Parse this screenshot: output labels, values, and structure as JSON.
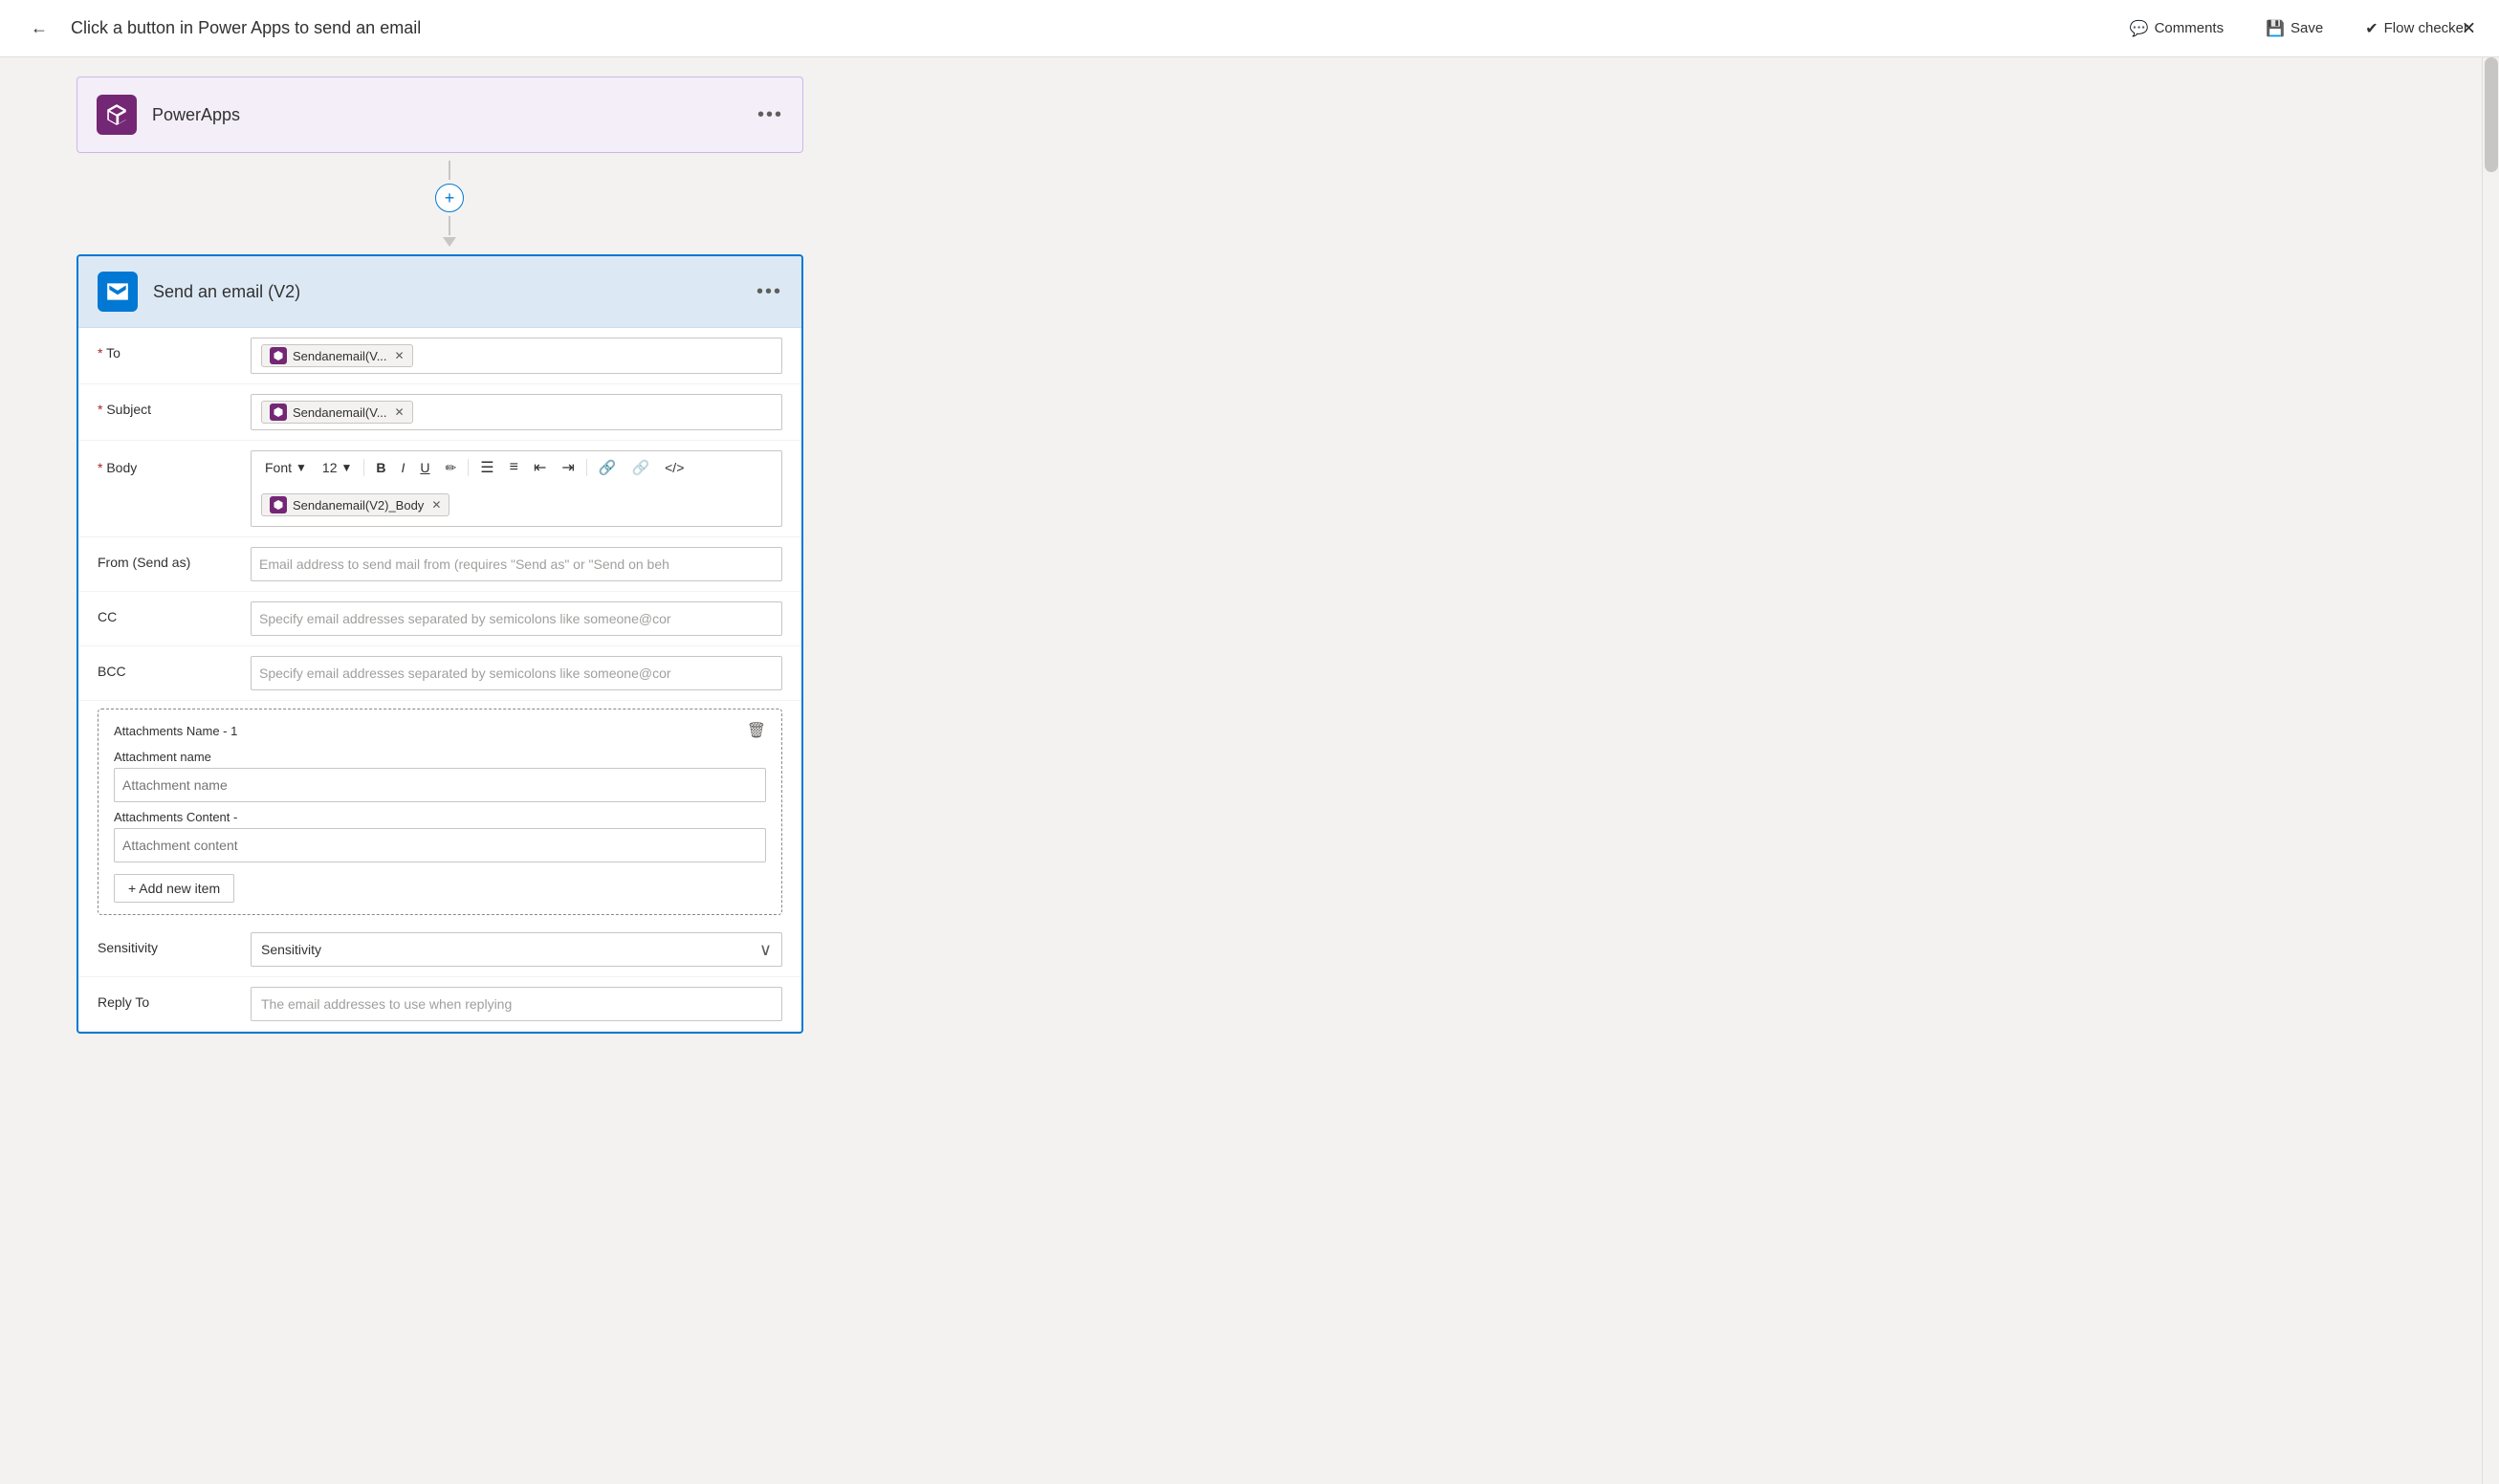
{
  "topbar": {
    "back_label": "←",
    "title": "Click a button in Power Apps to send an email",
    "comments_label": "Comments",
    "save_label": "Save",
    "flow_checker_label": "Flow checker",
    "close_label": "✕"
  },
  "powerapps_card": {
    "title": "PowerApps",
    "menu_label": "•••"
  },
  "connector": {
    "plus_label": "+",
    "plus_aria": "Add step"
  },
  "email_card": {
    "title": "Send an email (V2)",
    "menu_label": "•••"
  },
  "form": {
    "to_label": "To",
    "to_required": true,
    "to_token": "Sendanemail(V...",
    "subject_label": "Subject",
    "subject_required": true,
    "subject_token": "Sendanemail(V...",
    "body_label": "Body",
    "body_required": true,
    "body_font": "Font",
    "body_font_size": "12",
    "body_token": "Sendanemail(V2)_Body",
    "from_label": "From (Send as)",
    "from_placeholder": "Email address to send mail from (requires \"Send as\" or \"Send on beh",
    "cc_label": "CC",
    "cc_placeholder": "Specify email addresses separated by semicolons like someone@cor",
    "bcc_label": "BCC",
    "bcc_placeholder": "Specify email addresses separated by semicolons like someone@cor",
    "attachments_section_title": "Attachments Name - 1",
    "attachment_name_label": "Attachment name",
    "attachment_name_placeholder": "Attachment name",
    "attachment_content_label": "Attachments Content -",
    "attachment_content_placeholder": "Attachment content",
    "add_new_item_label": "+ Add new item",
    "sensitivity_label": "Sensitivity",
    "sensitivity_value": "Sensitivity",
    "reply_to_label": "Reply To",
    "reply_to_placeholder": "The email addresses to use when replying"
  },
  "toolbar": {
    "font_label": "Font",
    "font_size_label": "12",
    "bold_label": "B",
    "italic_label": "I",
    "underline_label": "U",
    "pen_label": "✏",
    "bullet_unordered_label": "≡",
    "bullet_ordered_label": "≡",
    "indent_decrease_label": "⇤",
    "indent_increase_label": "⇥",
    "link_label": "🔗",
    "unlink_label": "⛓",
    "code_label": "</>"
  },
  "colors": {
    "brand_purple": "#742774",
    "brand_blue": "#0078d4",
    "header_blue_bg": "#dce9f5",
    "border_blue": "#0078d4",
    "text_dark": "#323130",
    "text_mid": "#605e5c",
    "text_placeholder": "#a19f9d",
    "border_light": "#c8c6c4"
  }
}
